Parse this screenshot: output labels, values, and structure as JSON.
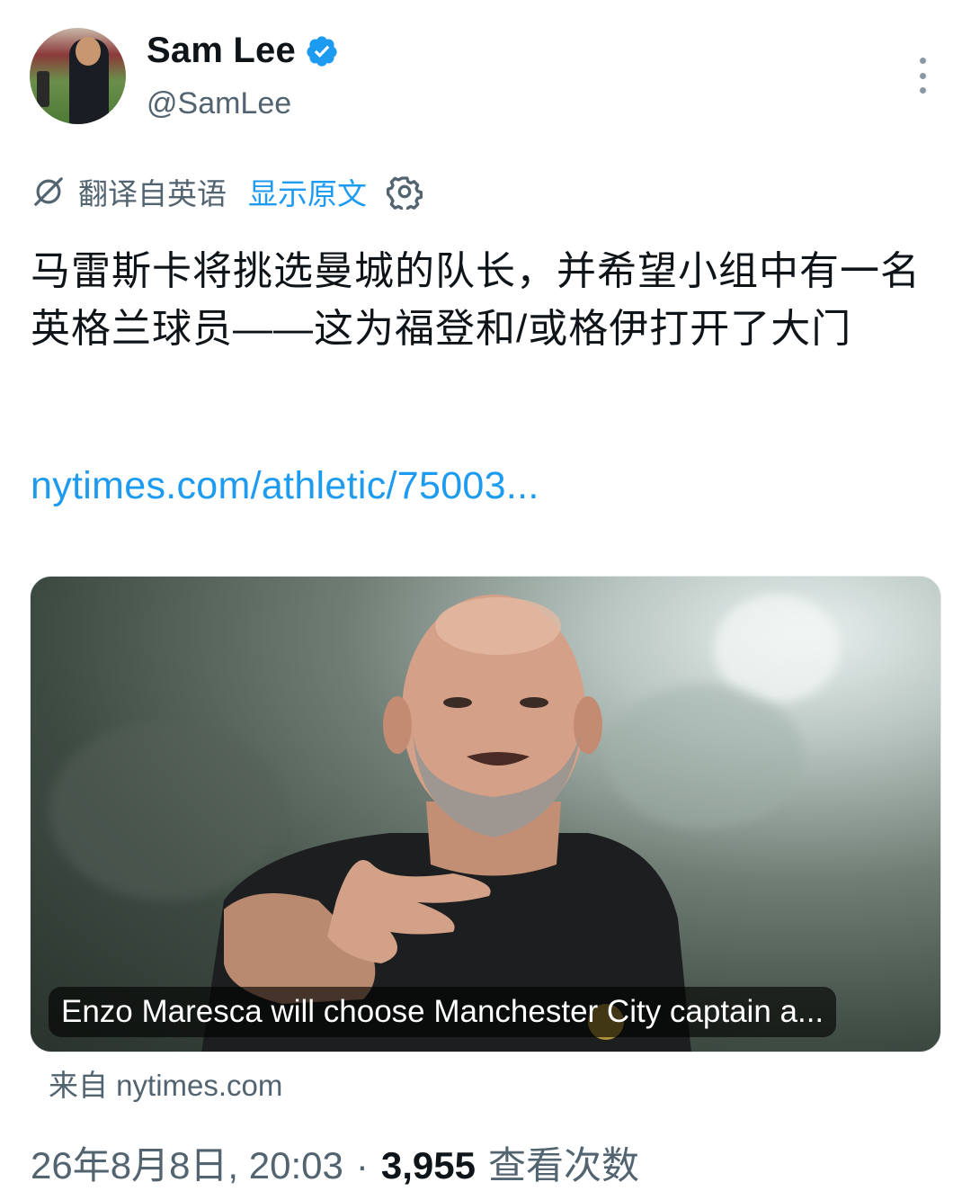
{
  "header": {
    "display_name": "Sam Lee",
    "handle": "@SamLee",
    "verified_icon": "verified-badge-icon",
    "more_icon": "more-vertical-icon"
  },
  "translation": {
    "icon": "translate-icon",
    "label": "翻译自英语",
    "show_original": "显示原文",
    "settings_icon": "gear-icon"
  },
  "tweet": {
    "text": "马雷斯卡将挑选曼城的队长，并希望小组中有一名英格兰球员——这为福登和/或格伊打开了大门",
    "link": "nytimes.com/athletic/75003..."
  },
  "card": {
    "caption": "Enzo Maresca will choose Manchester City captain a...",
    "source": "来自 nytimes.com"
  },
  "meta": {
    "datetime": "26年8月8日, 20:03",
    "separator": "·",
    "views_count": "3,955",
    "views_label": "查看次数"
  },
  "colors": {
    "accent": "#1d9bf0",
    "text_primary": "#0f1419",
    "text_secondary": "#536471"
  }
}
